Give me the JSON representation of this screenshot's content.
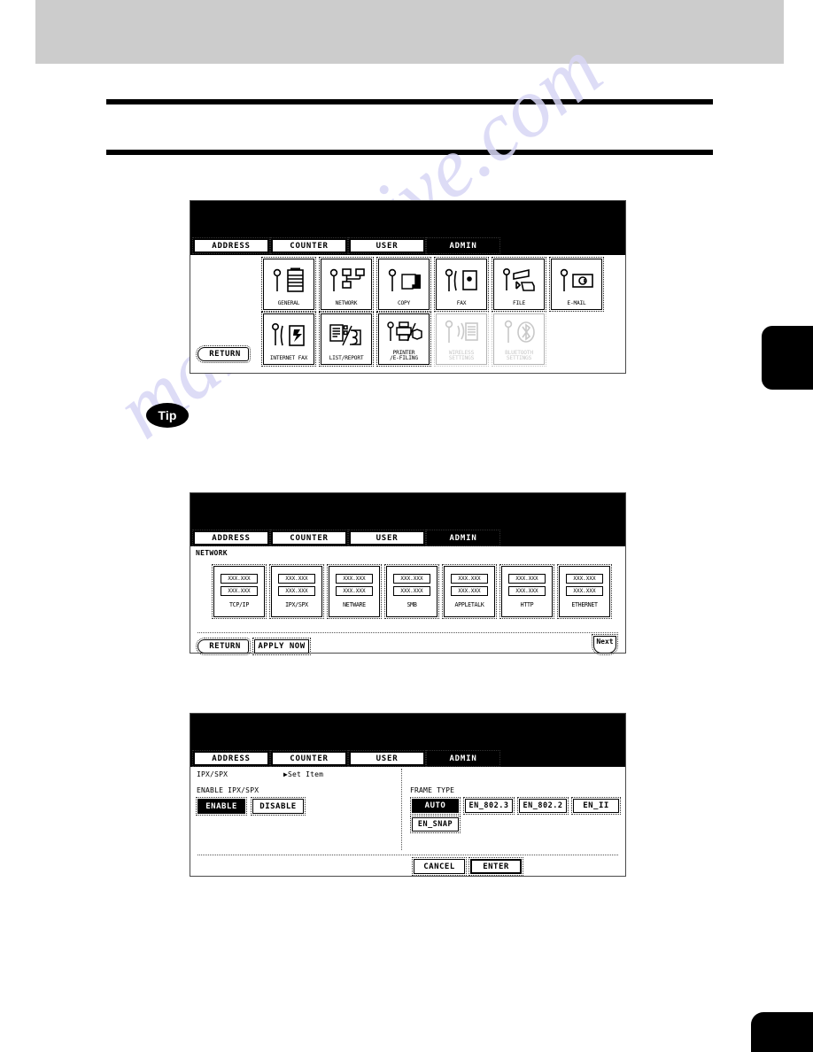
{
  "page": {
    "tip_badge": "Tip",
    "watermark": "manualshive.com"
  },
  "panel1": {
    "name": "admin-menu-screen",
    "tabs": [
      {
        "label": "ADDRESS",
        "selected": false
      },
      {
        "label": "COUNTER",
        "selected": false
      },
      {
        "label": "USER",
        "selected": false
      },
      {
        "label": "ADMIN",
        "selected": true
      }
    ],
    "return_label": "RETURN",
    "items": [
      {
        "label": "GENERAL",
        "icon": "wrench-copier-icon",
        "disabled": false
      },
      {
        "label": "NETWORK",
        "icon": "wrench-network-icon",
        "disabled": false
      },
      {
        "label": "COPY",
        "icon": "wrench-copy-icon",
        "disabled": false
      },
      {
        "label": "FAX",
        "icon": "wrench-fax-icon",
        "disabled": false
      },
      {
        "label": "FILE",
        "icon": "wrench-file-icon",
        "disabled": false
      },
      {
        "label": "E-MAIL",
        "icon": "wrench-email-icon",
        "disabled": false
      },
      {
        "label": "INTERNET FAX",
        "icon": "wrench-internetfax-icon",
        "disabled": false
      },
      {
        "label": "LIST/REPORT",
        "icon": "wrench-listreport-icon",
        "disabled": false
      },
      {
        "label": "PRINTER\n/E-FILING",
        "icon": "wrench-printer-icon",
        "disabled": false
      },
      {
        "label": "WIRELESS\nSETTINGS",
        "icon": "wrench-wireless-icon",
        "disabled": true
      },
      {
        "label": "BLUETOOTH\nSETTINGS",
        "icon": "wrench-bluetooth-icon",
        "disabled": true
      }
    ]
  },
  "panel2": {
    "name": "network-menu-screen",
    "tabs": [
      {
        "label": "ADDRESS",
        "selected": false
      },
      {
        "label": "COUNTER",
        "selected": false
      },
      {
        "label": "USER",
        "selected": false
      },
      {
        "label": "ADMIN",
        "selected": true
      }
    ],
    "section_label": "NETWORK",
    "field_value_top": "XXX.XXX",
    "field_value_bottom": "XXX.XXX",
    "items": [
      {
        "label": "TCP/IP"
      },
      {
        "label": "IPX/SPX"
      },
      {
        "label": "NETWARE"
      },
      {
        "label": "SMB"
      },
      {
        "label": "APPLETALK"
      },
      {
        "label": "HTTP"
      },
      {
        "label": "ETHERNET"
      }
    ],
    "return_label": "RETURN",
    "apply_label": "APPLY NOW",
    "next_label": "Next"
  },
  "panel3": {
    "name": "ipx-spx-settings-screen",
    "tabs": [
      {
        "label": "ADDRESS",
        "selected": false
      },
      {
        "label": "COUNTER",
        "selected": false
      },
      {
        "label": "USER",
        "selected": false
      },
      {
        "label": "ADMIN",
        "selected": true
      }
    ],
    "title": "IPX/SPX",
    "set_item": "▶Set Item",
    "enable_group_label": "ENABLE IPX/SPX",
    "enable_options": [
      {
        "label": "ENABLE",
        "selected": true
      },
      {
        "label": "DISABLE",
        "selected": false
      }
    ],
    "frame_type_label": "FRAME TYPE",
    "frame_type_options": [
      {
        "label": "AUTO",
        "selected": true
      },
      {
        "label": "EN_802.3",
        "selected": false
      },
      {
        "label": "EN_802.2",
        "selected": false
      },
      {
        "label": "EN_II",
        "selected": false
      },
      {
        "label": "EN_SNAP",
        "selected": false
      }
    ],
    "cancel_label": "CANCEL",
    "enter_label": "ENTER"
  }
}
